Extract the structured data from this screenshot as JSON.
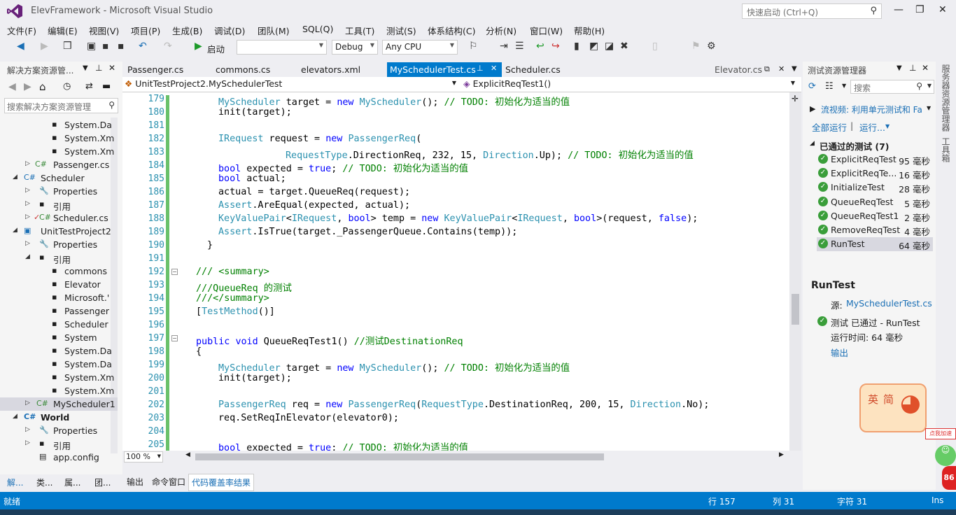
{
  "window": {
    "title": "ElevFramework - Microsoft Visual Studio",
    "quick_launch": "快速启动 (Ctrl+Q)"
  },
  "menu": [
    "文件(F)",
    "编辑(E)",
    "视图(V)",
    "项目(P)",
    "生成(B)",
    "调试(D)",
    "团队(M)",
    "SQL(Q)",
    "工具(T)",
    "测试(S)",
    "体系结构(C)",
    "分析(N)",
    "窗口(W)",
    "帮助(H)"
  ],
  "toolbar": {
    "start_label": "启动",
    "config": "Debug",
    "platform": "Any CPU"
  },
  "solution_explorer": {
    "title": "解决方案资源管...",
    "search_placeholder": "搜索解决方案资源管理",
    "items": [
      {
        "label": "System.Da"
      },
      {
        "label": "System.Xm"
      },
      {
        "label": "System.Xm"
      },
      {
        "label": "Passenger.cs"
      },
      {
        "label": "Scheduler"
      },
      {
        "label": "Properties"
      },
      {
        "label": "引用"
      },
      {
        "label": "Scheduler.cs"
      },
      {
        "label": "UnitTestProject2"
      },
      {
        "label": "Properties"
      },
      {
        "label": "引用"
      },
      {
        "label": "commons"
      },
      {
        "label": "Elevator"
      },
      {
        "label": "Microsoft.'"
      },
      {
        "label": "Passenger"
      },
      {
        "label": "Scheduler"
      },
      {
        "label": "System"
      },
      {
        "label": "System.Da"
      },
      {
        "label": "System.Da"
      },
      {
        "label": "System.Xm"
      },
      {
        "label": "System.Xm"
      },
      {
        "label": "MyScheduler1"
      },
      {
        "label": "World"
      },
      {
        "label": "Properties"
      },
      {
        "label": "引用"
      },
      {
        "label": "app.config"
      }
    ],
    "bottom_tabs": [
      "解...",
      "类...",
      "属...",
      "团..."
    ]
  },
  "editor": {
    "tabs": [
      "Passenger.cs",
      "commons.cs",
      "elevators.xml",
      "MyScedulerTest.cs",
      "Scheduler.cs",
      "Elevator.cs"
    ],
    "active_tab": "MySchedulerTest.cs",
    "nav_left": "UnitTestProject2.MySchedulerTest",
    "nav_right": "ExplicitReqTest1()",
    "zoom": "100 %",
    "lines": [
      {
        "n": "179",
        "code": "MyScheduler target = new MyScheduler(); // TODO: 初始化为适当的值"
      },
      {
        "n": "180",
        "code": "init(target);"
      },
      {
        "n": "181",
        "code": ""
      },
      {
        "n": "182",
        "code": "IRequest request = new PassengerReq("
      },
      {
        "n": "183",
        "code": "RequestType.DirectionReq, 232, 15, Direction.Up); // TODO: 初始化为适当的值"
      },
      {
        "n": "184",
        "code": "bool expected = true; // TODO: 初始化为适当的值"
      },
      {
        "n": "185",
        "code": "bool actual;"
      },
      {
        "n": "186",
        "code": "actual = target.QueueReq(request);"
      },
      {
        "n": "187",
        "code": "Assert.AreEqual(expected, actual);"
      },
      {
        "n": "188",
        "code": "KeyValuePair<IRequest, bool> temp = new KeyValuePair<IRequest, bool>(request, false);"
      },
      {
        "n": "189",
        "code": "Assert.IsTrue(target._PassengerQueue.Contains(temp));"
      },
      {
        "n": "190",
        "code": "}"
      },
      {
        "n": "191",
        "code": ""
      },
      {
        "n": "192",
        "code": "/// <summary>"
      },
      {
        "n": "193",
        "code": "///QueueReq 的测试"
      },
      {
        "n": "194",
        "code": "///</summary>"
      },
      {
        "n": "195",
        "code": "[TestMethod()]"
      },
      {
        "n": "196",
        "code": ""
      },
      {
        "n": "197",
        "code": "public void QueueReqTest1() //测试DestinationReq"
      },
      {
        "n": "198",
        "code": "{"
      },
      {
        "n": "199",
        "code": "MyScheduler target = new MyScheduler(); // TODO: 初始化为适当的值"
      },
      {
        "n": "200",
        "code": "init(target);"
      },
      {
        "n": "201",
        "code": ""
      },
      {
        "n": "202",
        "code": "PassengerReq req = new PassengerReq(RequestType.DestinationReq, 200, 15, Direction.No);"
      },
      {
        "n": "203",
        "code": "req.SetReqInElevator(elevator0);"
      },
      {
        "n": "204",
        "code": ""
      },
      {
        "n": "205",
        "code": "bool expected = true; // TODO: 初始化为适当的值"
      }
    ]
  },
  "output_tabs": [
    "输出",
    "命令窗口",
    "代码覆盖率结果"
  ],
  "test_explorer": {
    "title": "测试资源管理器",
    "search_placeholder": "搜索",
    "playlist": "流视频: 利用单元测试和 Fa",
    "run_all": "全部运行",
    "run": "运行...",
    "group": "已通过的测试 (7)",
    "tests": [
      {
        "name": "ExplicitReqTest",
        "time": "95 毫秒"
      },
      {
        "name": "ExplicitReqTe...",
        "time": "16 毫秒"
      },
      {
        "name": "InitializeTest",
        "time": "28 毫秒"
      },
      {
        "name": "QueueReqTest",
        "time": "5 毫秒"
      },
      {
        "name": "QueueReqTest1",
        "time": "2 毫秒"
      },
      {
        "name": "RemoveReqTest",
        "time": "4 毫秒"
      },
      {
        "name": "RunTest",
        "time": "64 毫秒"
      }
    ],
    "detail": {
      "title": "RunTest",
      "source_label": "源:",
      "source": "MySchedulerTest.cs ,",
      "result": "测试 已通过 - RunTest",
      "elapsed": "运行时间: 64 毫秒",
      "output": "输出"
    }
  },
  "side_tabs": [
    "服务器资源管理器",
    "工具箱"
  ],
  "status": {
    "ready": "就绪",
    "line": "行 157",
    "col": "列 31",
    "char": "字符 31",
    "mode": "Ins"
  },
  "widget": {
    "text1": "英",
    "text2": "简",
    "badge": "点我加速",
    "counter": "86"
  }
}
